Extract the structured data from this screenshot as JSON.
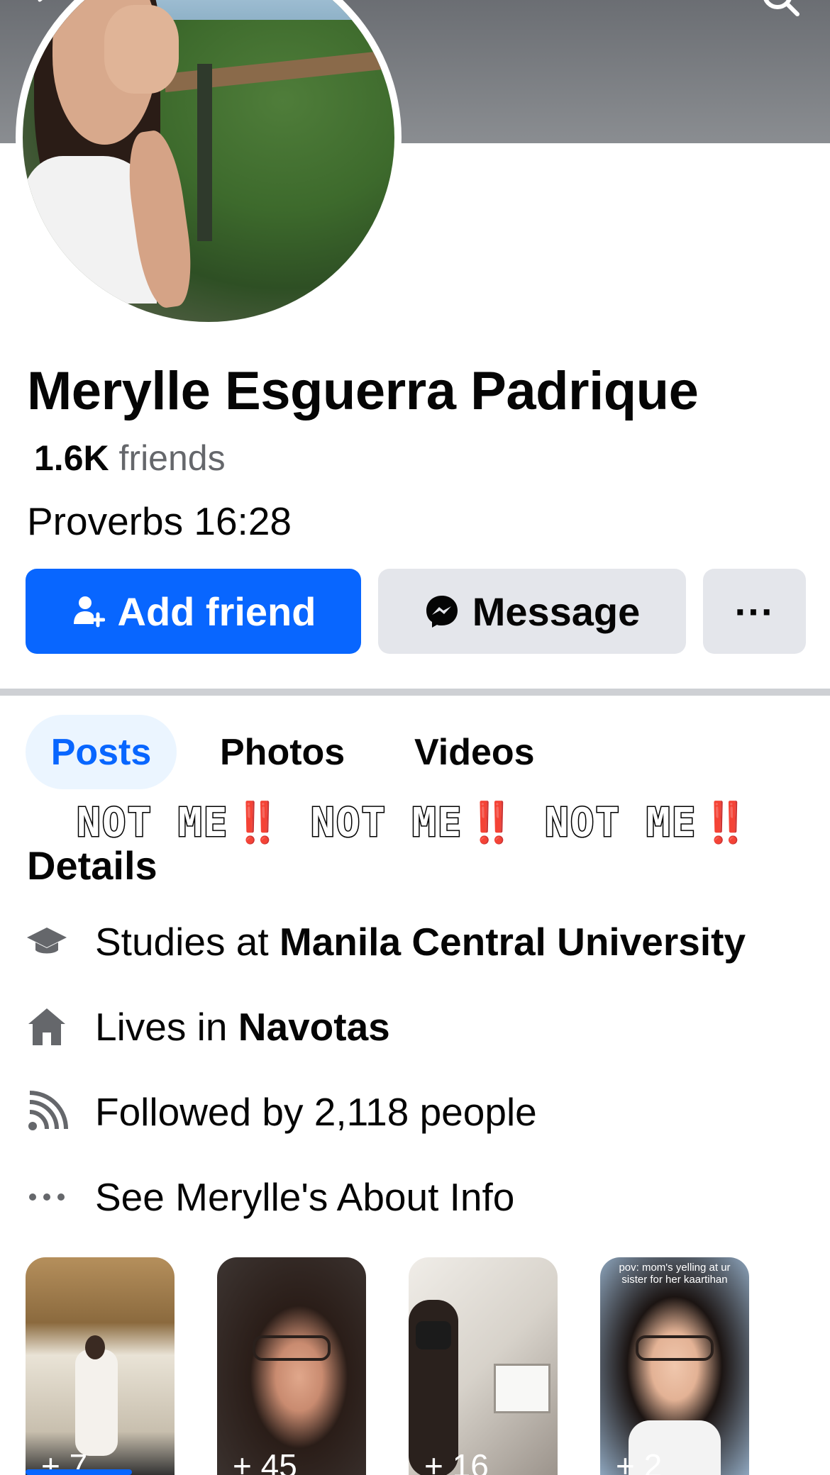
{
  "profile": {
    "name": "Merylle Esguerra Padrique",
    "friends_count": "1.6K",
    "friends_label": "friends",
    "bio": "Proverbs 16:28"
  },
  "actions": {
    "add_friend": "Add friend",
    "message": "Message",
    "more": "···"
  },
  "tabs": [
    {
      "label": "Posts",
      "active": true
    },
    {
      "label": "Photos",
      "active": false
    },
    {
      "label": "Videos",
      "active": false
    }
  ],
  "overlay": {
    "items": [
      "NOT ME",
      "NOT ME",
      "NOT ME"
    ],
    "bang": "‼️"
  },
  "details": {
    "title": "Details",
    "studies_prefix": "Studies at ",
    "studies_school": "Manila Central University",
    "lives_prefix": "Lives in ",
    "lives_city": "Navotas",
    "followed": "Followed by 2,118 people",
    "about": "See Merylle's About Info"
  },
  "thumbnails": [
    {
      "count": "+ 7",
      "caption": ""
    },
    {
      "count": "+ 45",
      "caption": ""
    },
    {
      "count": "+ 16",
      "caption": ""
    },
    {
      "count": "+ 2",
      "caption": "pov: mom's yelling at ur sister for her kaartihan"
    }
  ],
  "colors": {
    "brand_blue": "#0866ff",
    "button_gray": "#e4e6eb",
    "secondary_text": "#65676b",
    "alert_red": "#e8232a"
  },
  "icons": [
    "back-arrow-icon",
    "search-icon",
    "add-friend-icon",
    "messenger-icon",
    "graduation-cap-icon",
    "home-icon",
    "rss-followers-icon",
    "more-dots-icon"
  ]
}
